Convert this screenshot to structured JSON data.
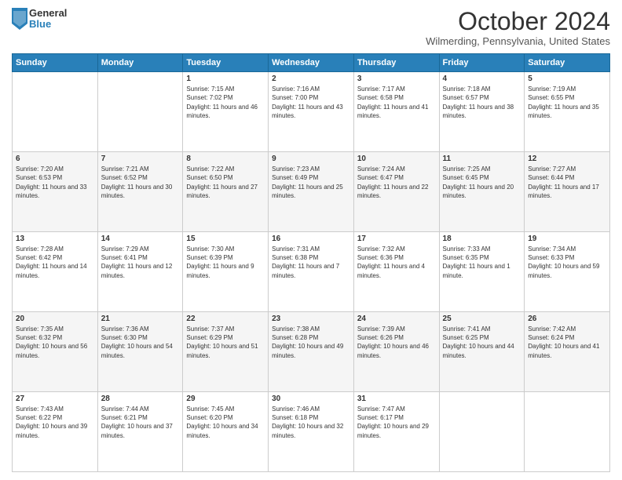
{
  "logo": {
    "general": "General",
    "blue": "Blue"
  },
  "header": {
    "month_year": "October 2024",
    "location": "Wilmerding, Pennsylvania, United States"
  },
  "weekdays": [
    "Sunday",
    "Monday",
    "Tuesday",
    "Wednesday",
    "Thursday",
    "Friday",
    "Saturday"
  ],
  "weeks": [
    [
      {
        "day": "",
        "sunrise": "",
        "sunset": "",
        "daylight": ""
      },
      {
        "day": "",
        "sunrise": "",
        "sunset": "",
        "daylight": ""
      },
      {
        "day": "1",
        "sunrise": "Sunrise: 7:15 AM",
        "sunset": "Sunset: 7:02 PM",
        "daylight": "Daylight: 11 hours and 46 minutes."
      },
      {
        "day": "2",
        "sunrise": "Sunrise: 7:16 AM",
        "sunset": "Sunset: 7:00 PM",
        "daylight": "Daylight: 11 hours and 43 minutes."
      },
      {
        "day": "3",
        "sunrise": "Sunrise: 7:17 AM",
        "sunset": "Sunset: 6:58 PM",
        "daylight": "Daylight: 11 hours and 41 minutes."
      },
      {
        "day": "4",
        "sunrise": "Sunrise: 7:18 AM",
        "sunset": "Sunset: 6:57 PM",
        "daylight": "Daylight: 11 hours and 38 minutes."
      },
      {
        "day": "5",
        "sunrise": "Sunrise: 7:19 AM",
        "sunset": "Sunset: 6:55 PM",
        "daylight": "Daylight: 11 hours and 35 minutes."
      }
    ],
    [
      {
        "day": "6",
        "sunrise": "Sunrise: 7:20 AM",
        "sunset": "Sunset: 6:53 PM",
        "daylight": "Daylight: 11 hours and 33 minutes."
      },
      {
        "day": "7",
        "sunrise": "Sunrise: 7:21 AM",
        "sunset": "Sunset: 6:52 PM",
        "daylight": "Daylight: 11 hours and 30 minutes."
      },
      {
        "day": "8",
        "sunrise": "Sunrise: 7:22 AM",
        "sunset": "Sunset: 6:50 PM",
        "daylight": "Daylight: 11 hours and 27 minutes."
      },
      {
        "day": "9",
        "sunrise": "Sunrise: 7:23 AM",
        "sunset": "Sunset: 6:49 PM",
        "daylight": "Daylight: 11 hours and 25 minutes."
      },
      {
        "day": "10",
        "sunrise": "Sunrise: 7:24 AM",
        "sunset": "Sunset: 6:47 PM",
        "daylight": "Daylight: 11 hours and 22 minutes."
      },
      {
        "day": "11",
        "sunrise": "Sunrise: 7:25 AM",
        "sunset": "Sunset: 6:45 PM",
        "daylight": "Daylight: 11 hours and 20 minutes."
      },
      {
        "day": "12",
        "sunrise": "Sunrise: 7:27 AM",
        "sunset": "Sunset: 6:44 PM",
        "daylight": "Daylight: 11 hours and 17 minutes."
      }
    ],
    [
      {
        "day": "13",
        "sunrise": "Sunrise: 7:28 AM",
        "sunset": "Sunset: 6:42 PM",
        "daylight": "Daylight: 11 hours and 14 minutes."
      },
      {
        "day": "14",
        "sunrise": "Sunrise: 7:29 AM",
        "sunset": "Sunset: 6:41 PM",
        "daylight": "Daylight: 11 hours and 12 minutes."
      },
      {
        "day": "15",
        "sunrise": "Sunrise: 7:30 AM",
        "sunset": "Sunset: 6:39 PM",
        "daylight": "Daylight: 11 hours and 9 minutes."
      },
      {
        "day": "16",
        "sunrise": "Sunrise: 7:31 AM",
        "sunset": "Sunset: 6:38 PM",
        "daylight": "Daylight: 11 hours and 7 minutes."
      },
      {
        "day": "17",
        "sunrise": "Sunrise: 7:32 AM",
        "sunset": "Sunset: 6:36 PM",
        "daylight": "Daylight: 11 hours and 4 minutes."
      },
      {
        "day": "18",
        "sunrise": "Sunrise: 7:33 AM",
        "sunset": "Sunset: 6:35 PM",
        "daylight": "Daylight: 11 hours and 1 minute."
      },
      {
        "day": "19",
        "sunrise": "Sunrise: 7:34 AM",
        "sunset": "Sunset: 6:33 PM",
        "daylight": "Daylight: 10 hours and 59 minutes."
      }
    ],
    [
      {
        "day": "20",
        "sunrise": "Sunrise: 7:35 AM",
        "sunset": "Sunset: 6:32 PM",
        "daylight": "Daylight: 10 hours and 56 minutes."
      },
      {
        "day": "21",
        "sunrise": "Sunrise: 7:36 AM",
        "sunset": "Sunset: 6:30 PM",
        "daylight": "Daylight: 10 hours and 54 minutes."
      },
      {
        "day": "22",
        "sunrise": "Sunrise: 7:37 AM",
        "sunset": "Sunset: 6:29 PM",
        "daylight": "Daylight: 10 hours and 51 minutes."
      },
      {
        "day": "23",
        "sunrise": "Sunrise: 7:38 AM",
        "sunset": "Sunset: 6:28 PM",
        "daylight": "Daylight: 10 hours and 49 minutes."
      },
      {
        "day": "24",
        "sunrise": "Sunrise: 7:39 AM",
        "sunset": "Sunset: 6:26 PM",
        "daylight": "Daylight: 10 hours and 46 minutes."
      },
      {
        "day": "25",
        "sunrise": "Sunrise: 7:41 AM",
        "sunset": "Sunset: 6:25 PM",
        "daylight": "Daylight: 10 hours and 44 minutes."
      },
      {
        "day": "26",
        "sunrise": "Sunrise: 7:42 AM",
        "sunset": "Sunset: 6:24 PM",
        "daylight": "Daylight: 10 hours and 41 minutes."
      }
    ],
    [
      {
        "day": "27",
        "sunrise": "Sunrise: 7:43 AM",
        "sunset": "Sunset: 6:22 PM",
        "daylight": "Daylight: 10 hours and 39 minutes."
      },
      {
        "day": "28",
        "sunrise": "Sunrise: 7:44 AM",
        "sunset": "Sunset: 6:21 PM",
        "daylight": "Daylight: 10 hours and 37 minutes."
      },
      {
        "day": "29",
        "sunrise": "Sunrise: 7:45 AM",
        "sunset": "Sunset: 6:20 PM",
        "daylight": "Daylight: 10 hours and 34 minutes."
      },
      {
        "day": "30",
        "sunrise": "Sunrise: 7:46 AM",
        "sunset": "Sunset: 6:18 PM",
        "daylight": "Daylight: 10 hours and 32 minutes."
      },
      {
        "day": "31",
        "sunrise": "Sunrise: 7:47 AM",
        "sunset": "Sunset: 6:17 PM",
        "daylight": "Daylight: 10 hours and 29 minutes."
      },
      {
        "day": "",
        "sunrise": "",
        "sunset": "",
        "daylight": ""
      },
      {
        "day": "",
        "sunrise": "",
        "sunset": "",
        "daylight": ""
      }
    ]
  ]
}
